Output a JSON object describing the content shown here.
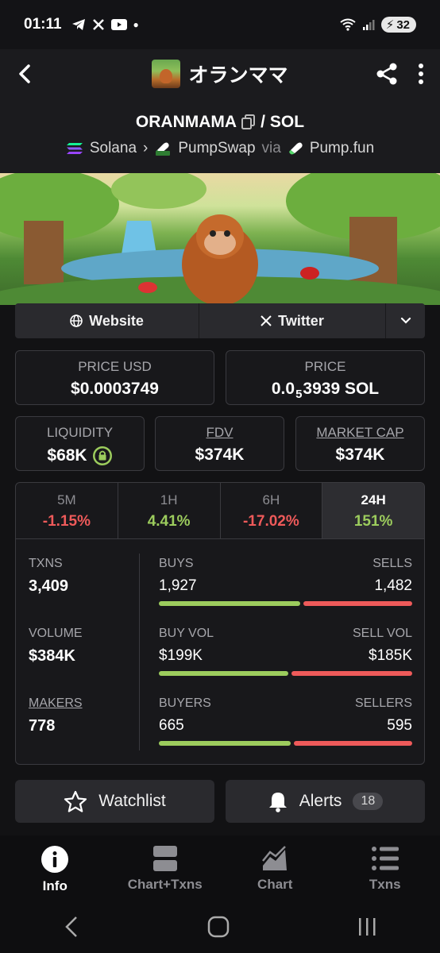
{
  "status": {
    "time": "01:11",
    "battery": "32"
  },
  "header": {
    "title": "オランママ"
  },
  "pair": {
    "base": "ORANMAMA",
    "separator": "/",
    "quote": "SOL",
    "chain": "Solana",
    "dex": "PumpSwap",
    "via_label": "via",
    "launchpad": "Pump.fun"
  },
  "links": {
    "website": "Website",
    "twitter": "Twitter"
  },
  "prices": {
    "usd_label": "PRICE USD",
    "usd_value": "$0.0003749",
    "native_label": "PRICE",
    "native_prefix": "0.0",
    "native_sub": "5",
    "native_digits": "3939 SOL"
  },
  "metrics": {
    "liquidity_label": "LIQUIDITY",
    "liquidity_value": "$68K",
    "fdv_label": "FDV",
    "fdv_value": "$374K",
    "mcap_label": "MARKET CAP",
    "mcap_value": "$374K"
  },
  "timeframes": [
    {
      "label": "5M",
      "value": "-1.15%"
    },
    {
      "label": "1H",
      "value": "4.41%"
    },
    {
      "label": "6H",
      "value": "-17.02%"
    },
    {
      "label": "24H",
      "value": "151%"
    }
  ],
  "stats": {
    "txns_label": "TXNS",
    "txns_value": "3,409",
    "volume_label": "VOLUME",
    "volume_value": "$384K",
    "makers_label": "MAKERS",
    "makers_value": "778",
    "buys_label": "BUYS",
    "buys_value": "1,927",
    "sells_label": "SELLS",
    "sells_value": "1,482",
    "buy_vol_label": "BUY VOL",
    "buy_vol_value": "$199K",
    "sell_vol_label": "SELL VOL",
    "sell_vol_value": "$185K",
    "buyers_label": "BUYERS",
    "buyers_value": "665",
    "sellers_label": "SELLERS",
    "sellers_value": "595"
  },
  "actions": {
    "watchlist": "Watchlist",
    "alerts": "Alerts",
    "alerts_count": "18"
  },
  "nav": {
    "info": "Info",
    "chart_txns": "Chart+Txns",
    "chart": "Chart",
    "txns": "Txns"
  },
  "colors": {
    "positive": "#9ccc5d",
    "negative": "#ee5a5a",
    "background": "#121214"
  }
}
